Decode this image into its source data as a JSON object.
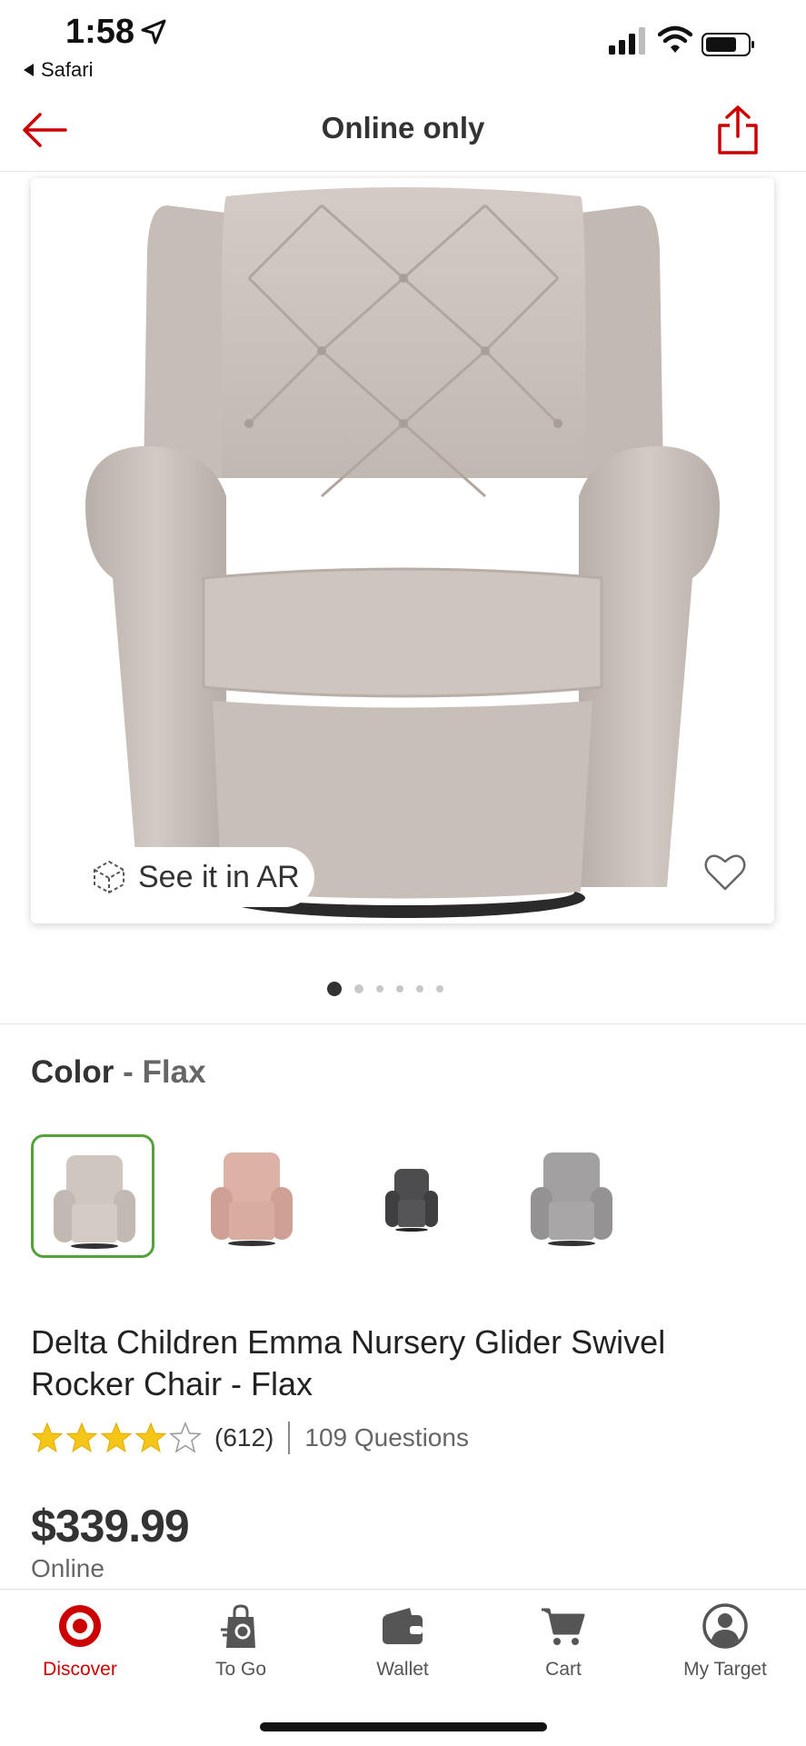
{
  "status_bar": {
    "time": "1:58",
    "back_app": "Safari"
  },
  "header": {
    "title": "Online only"
  },
  "gallery": {
    "ar_label": "See it in AR",
    "dot_count": 6,
    "active_dot": 0
  },
  "color": {
    "label": "Color",
    "separator": " - ",
    "value": "Flax",
    "swatches": [
      {
        "name": "Flax",
        "hex": "#cfc6c0",
        "selected": true
      },
      {
        "name": "Blush",
        "hex": "#d7aca0",
        "selected": false
      },
      {
        "name": "Charcoal",
        "hex": "#4a4a4c",
        "selected": false
      },
      {
        "name": "Gray",
        "hex": "#9e9b9c",
        "selected": false
      }
    ]
  },
  "product": {
    "title": "Delta Children Emma Nursery Glider Swivel Rocker Chair - Flax",
    "rating": 4,
    "rating_max": 5,
    "review_count": "(612)",
    "questions": "109 Questions",
    "price": "$339.99",
    "price_note": "Online"
  },
  "tabbar": {
    "items": [
      {
        "label": "Discover",
        "icon": "target-bullseye-icon",
        "active": true
      },
      {
        "label": "To Go",
        "icon": "shopping-bag-icon",
        "active": false
      },
      {
        "label": "Wallet",
        "icon": "wallet-icon",
        "active": false
      },
      {
        "label": "Cart",
        "icon": "cart-icon",
        "active": false
      },
      {
        "label": "My Target",
        "icon": "account-icon",
        "active": false
      }
    ]
  },
  "colors": {
    "brand_red": "#cc0000",
    "selected_green": "#55a13c",
    "star_gold": "#f5c518"
  }
}
